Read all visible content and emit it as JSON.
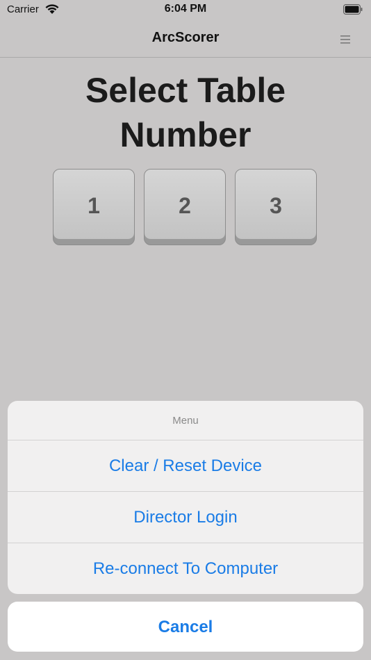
{
  "status_bar": {
    "carrier": "Carrier",
    "time": "6:04 PM"
  },
  "nav": {
    "title": "ArcScorer",
    "menu_icon": "hamburger-icon"
  },
  "main": {
    "heading_line1": "Select Table",
    "heading_line2": "Number",
    "tables": [
      "1",
      "2",
      "3"
    ]
  },
  "action_sheet": {
    "title": "Menu",
    "items": [
      "Clear / Reset Device",
      "Director Login",
      "Re-connect To Computer"
    ],
    "cancel": "Cancel"
  },
  "colors": {
    "background": "#c8c6c6",
    "accent": "#1a7ce6"
  }
}
